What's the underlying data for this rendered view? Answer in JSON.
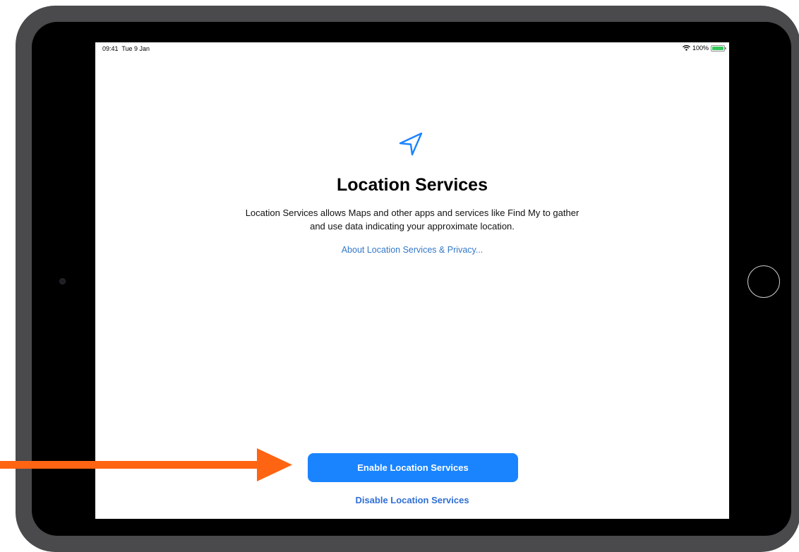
{
  "status_bar": {
    "time": "09:41",
    "date": "Tue 9 Jan",
    "battery": "100%",
    "wifi_icon": "wifi-icon",
    "battery_icon": "battery-icon"
  },
  "main": {
    "icon": "location-arrow-icon",
    "title": "Location Services",
    "description_line1": "Location Services allows Maps and other apps and services like Find My to gather",
    "description_line2": "and use data indicating your approximate location.",
    "about_link": "About Location Services & Privacy..."
  },
  "actions": {
    "enable_label": "Enable Location Services",
    "disable_label": "Disable Location Services"
  },
  "colors": {
    "accent": "#1a84ff",
    "link": "#3478c8",
    "annotation_arrow": "#ff6412",
    "device_frame": "#4a4a4c",
    "battery": "#34c759"
  }
}
